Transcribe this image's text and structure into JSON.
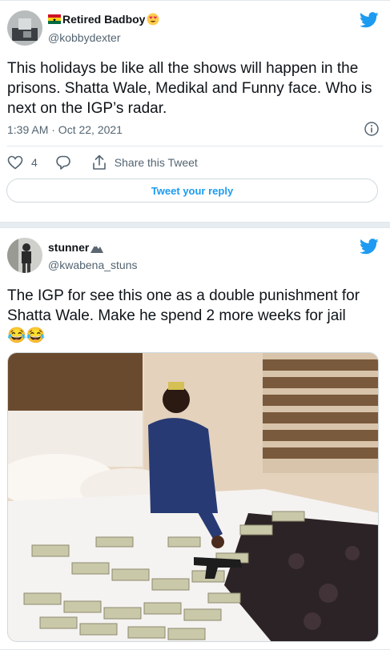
{
  "tweet1": {
    "display_name": "Retired Badboy",
    "name_emojis": [
      "flag-ghana",
      "heart-eyes"
    ],
    "handle": "@kobbydexter",
    "text": "This holidays be like all the shows will happen in the prisons. Shatta Wale, Medikal and Funny face. Who is next on the IGP’s radar.",
    "timestamp": "1:39 AM · Oct 22, 2021",
    "like_count": "4",
    "share_label": "Share this Tweet",
    "reply_prompt": "Tweet your reply"
  },
  "tweet2": {
    "display_name": "stunner",
    "name_emojis": [
      "mountain"
    ],
    "handle": "@kwabena_stuns",
    "text": "The IGP for see this one as a double  punishment for Shatta Wale. Make he spend 2 more weeks for jail",
    "text_emojis": "😂😂"
  },
  "colors": {
    "twitter_blue": "#1d9bf0",
    "secondary_text": "#536471",
    "divider": "#e1e8ed"
  }
}
